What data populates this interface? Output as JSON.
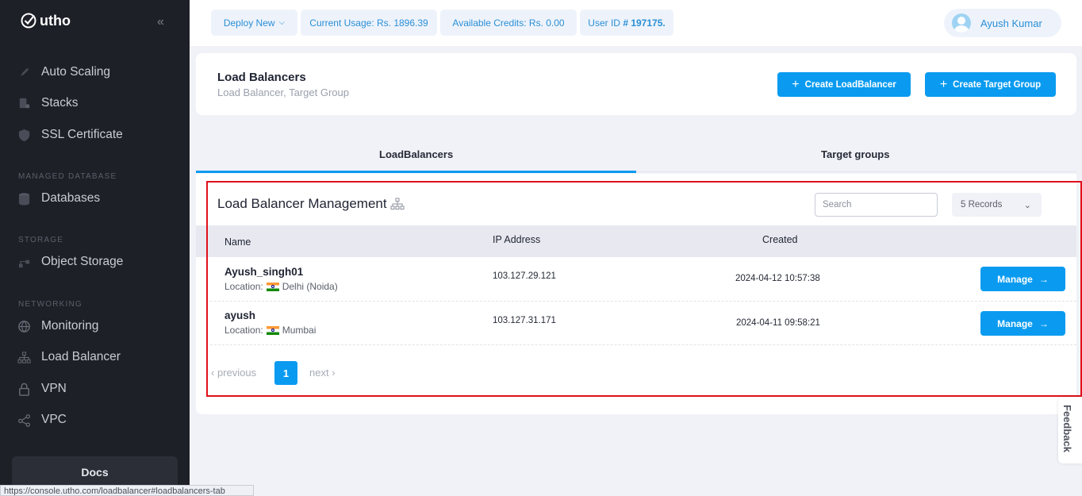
{
  "sidebar": {
    "brand": "utho",
    "items": [
      {
        "label": "Auto Scaling",
        "icon": "rocket-icon"
      },
      {
        "label": "Stacks",
        "icon": "stack-icon"
      },
      {
        "label": "SSL Certificate",
        "icon": "shield-icon"
      },
      {
        "label": "Databases",
        "icon": "database-icon"
      },
      {
        "label": "Object Storage",
        "icon": "object-storage-icon"
      },
      {
        "label": "Monitoring",
        "icon": "globe-icon"
      },
      {
        "label": "Load Balancer",
        "icon": "sitemap-icon"
      },
      {
        "label": "VPN",
        "icon": "lock-icon"
      },
      {
        "label": "VPC",
        "icon": "share-icon"
      }
    ],
    "sections": {
      "managed_database": "MANAGED DATABASE",
      "storage": "STORAGE",
      "networking": "NETWORKING"
    },
    "docs_label": "Docs"
  },
  "topbar": {
    "deploy_label": "Deploy New",
    "usage": "Current Usage: Rs. 1896.39",
    "credits": "Available Credits: Rs. 0.00",
    "user_id_prefix": "User ID",
    "user_id_value": "# 197175.",
    "user_name": "Ayush Kumar"
  },
  "header": {
    "title": "Load Balancers",
    "subtitle": "Load Balancer, Target Group",
    "create_lb": "Create LoadBalancer",
    "create_tg": "Create Target Group"
  },
  "tabs": {
    "lb": "LoadBalancers",
    "tg": "Target groups"
  },
  "management": {
    "title": "Load Balancer Management",
    "search_placeholder": "Search",
    "records": "5 Records",
    "columns": {
      "name": "Name",
      "ip": "IP Address",
      "created": "Created"
    },
    "location_label": "Location:",
    "rows": [
      {
        "name": "Ayush_singh01",
        "location": "Delhi (Noida)",
        "ip": "103.127.29.121",
        "created": "2024-04-12 10:57:38",
        "action": "Manage"
      },
      {
        "name": "ayush",
        "location": "Mumbai",
        "ip": "103.127.31.171",
        "created": "2024-04-11 09:58:21",
        "action": "Manage"
      }
    ],
    "pager": {
      "prev": "previous",
      "page": "1",
      "next": "next"
    }
  },
  "feedback_label": "Feedback",
  "status_url": "https://console.utho.com/loadbalancer#loadbalancers-tab",
  "colors": {
    "accent": "#0a9bf0",
    "sidebar_bg": "#1e2028",
    "highlight": "#e0101a"
  }
}
